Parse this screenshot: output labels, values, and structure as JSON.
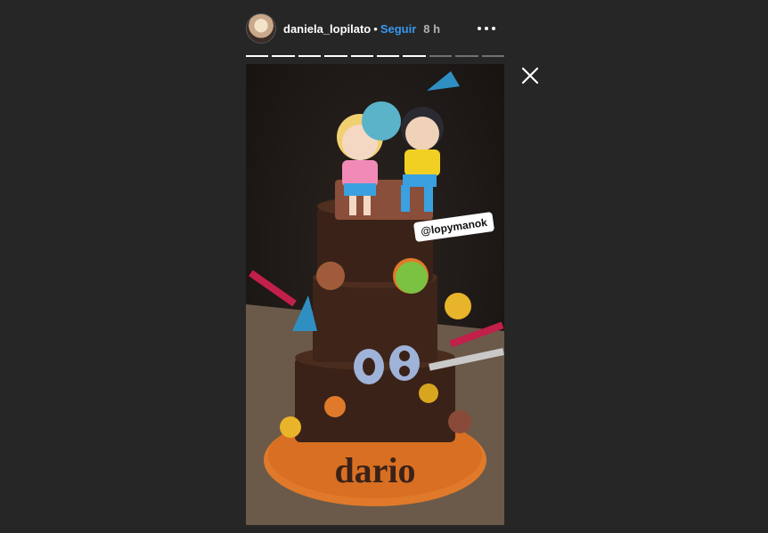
{
  "header": {
    "username": "daniela_lopilato",
    "dot": "•",
    "follow_label": "Seguir",
    "time": "8 h",
    "more_icon": "more-dots-icon"
  },
  "progress": {
    "total_segments": 10,
    "completed_segments": 7
  },
  "story": {
    "mention": "@lopymanok",
    "cake_name": "dario",
    "cake_number": "08"
  },
  "colors": {
    "background": "#262626",
    "follow": "#3897f0",
    "story_bg": "#1e1a18"
  },
  "close_icon": "close-icon"
}
